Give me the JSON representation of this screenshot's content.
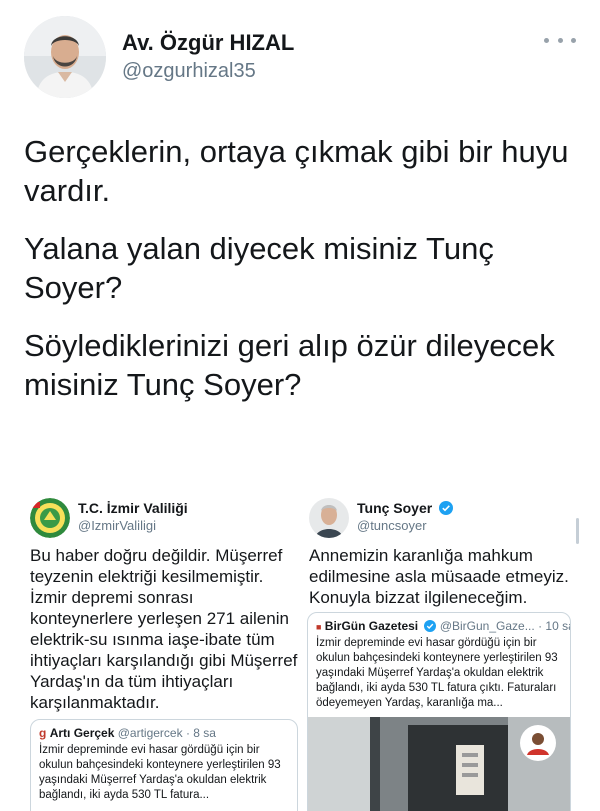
{
  "author": {
    "name": "Av. Özgür HIZAL",
    "handle": "@ozgurhizal35"
  },
  "tweet": {
    "paragraphs": [
      "Gerçeklerin, ortaya çıkmak gibi bir huyu vardır.",
      "Yalana yalan diyecek misiniz Tunç Soyer?",
      "Söylediklerinizi geri alıp özür dileyecek misiniz Tunç Soyer?"
    ]
  },
  "left_shot": {
    "name": "T.C. İzmir Valiliği",
    "handle": "@IzmirValiligi",
    "text": "Bu haber doğru değildir. Müşerref teyzenin elektriği kesilmemiştir. İzmir depremi sonrası konteynerlere yerleşen 271 ailenin elektrik-su ısınma iaşe-ibate tüm ihtiyaçları karşılandığı gibi Müşerref Yardaş'ın da tüm ihtiyaçları karşılanmaktadır.",
    "quote": {
      "name": "Artı Gerçek",
      "handle": "@artigercek",
      "time": "· 8 sa",
      "text": "İzmir depreminde evi hasar gördüğü için bir okulun bahçesindeki konteynere yerleştirilen 93 yaşındaki Müşerref Yardaş'a okuldan elektrik bağlandı, iki ayda 530 TL fatura..."
    }
  },
  "right_shot": {
    "name": "Tunç Soyer",
    "handle": "@tuncsoyer",
    "text": "Annemizin karanlığa mahkum edilmesine asla müsaade etmeyiz. Konuyla bizzat ilgileneceğim.",
    "quote": {
      "name": "BirGün Gazetesi",
      "handle": "@BirGun_Gaze...",
      "time": "· 10 sa",
      "text": "İzmir depreminde evi hasar gördüğü için bir okulun bahçesindeki konteynere yerleştirilen 93 yaşındaki Müşerref Yardaş'a okuldan elektrik bağlandı, iki ayda 530 TL fatura çıktı. Faturaları ödeyemeyen Yardaş, karanlığa ma..."
    }
  }
}
